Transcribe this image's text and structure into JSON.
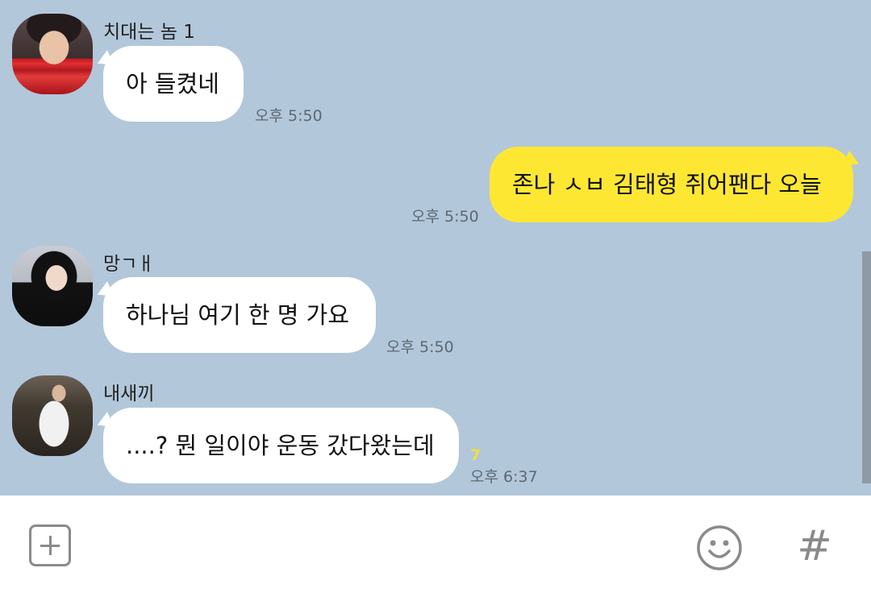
{
  "messages": [
    {
      "sender": "치대는 놈 1",
      "text": "아 들켰네",
      "time": "오후 5:50",
      "direction": "in"
    },
    {
      "sender": "",
      "text": "존나 ㅅㅂ 김태형 쥐어팬다 오늘",
      "time": "오후 5:50",
      "direction": "out"
    },
    {
      "sender": "망ㄱㅐ",
      "text": "하나님 여기 한 명 가요",
      "time": "오후 5:50",
      "direction": "in"
    },
    {
      "sender": "내새끼",
      "text": "....? 뭔 일이야 운동 갔다왔는데",
      "time": "오후 6:37",
      "direction": "in",
      "unread": "7"
    }
  ],
  "input_bar": {
    "add_icon": "plus-square-icon",
    "emoji_icon": "smiley-icon",
    "hash_icon": "hash-icon",
    "hash_label": "#"
  },
  "colors": {
    "background": "#b2c7da",
    "incoming_bubble": "#ffffff",
    "outgoing_bubble": "#fee733",
    "unread_count": "#f0e040"
  }
}
